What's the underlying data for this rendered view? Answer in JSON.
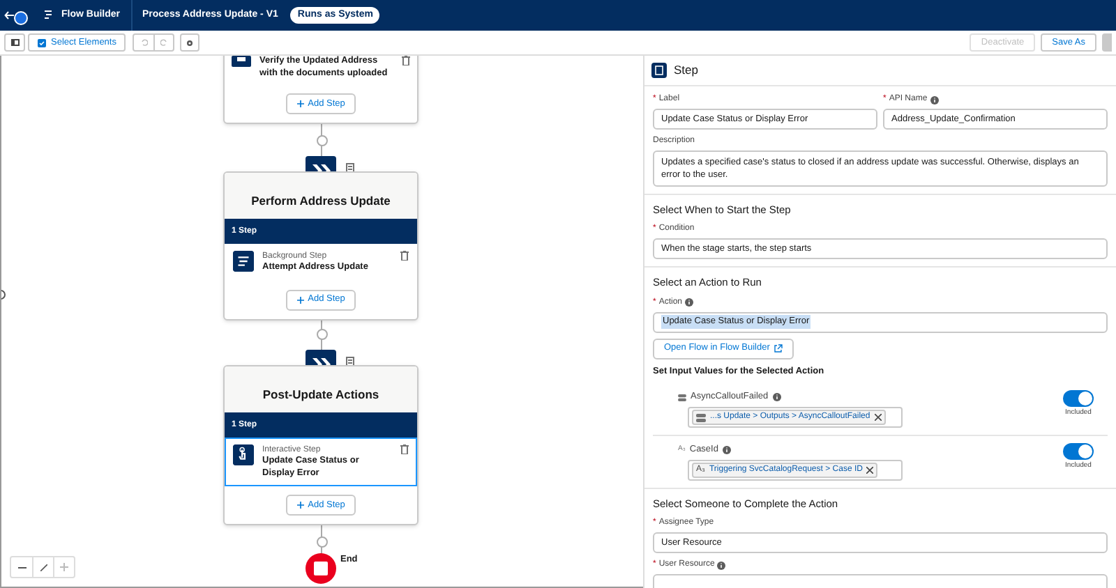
{
  "header": {
    "app_name": "Flow Builder",
    "flow_title": "Process Address Update - V1",
    "run_badge": "Runs as System"
  },
  "toolbar": {
    "select_elements": "Select Elements",
    "actions": [
      {
        "label": "Deactivate",
        "disabled": true
      },
      {
        "label": "Save As",
        "disabled": false
      }
    ]
  },
  "canvas": {
    "stages": [
      {
        "kind": "partial",
        "steps": [
          {
            "kind": "screen",
            "name": "Verify the Updated Address with the documents uploaded",
            "selected": false
          }
        ],
        "add_step": "Add Step"
      },
      {
        "kind": "full",
        "title": "Perform Address Update",
        "count": "1 Step",
        "steps": [
          {
            "kind": "background",
            "type": "Background Step",
            "name": "Attempt Address Update",
            "selected": false
          }
        ],
        "add_step": "Add Step"
      },
      {
        "kind": "full",
        "title": "Post-Update Actions",
        "count": "1 Step",
        "steps": [
          {
            "kind": "interactive",
            "type": "Interactive Step",
            "name": "Update Case Status or Display Error",
            "selected": true
          }
        ],
        "add_step": "Add Step"
      }
    ],
    "end_label": "End"
  },
  "panel": {
    "title": "Step",
    "label": {
      "required_mark": "*",
      "label": "Label",
      "value": "Update Case Status or Display Error"
    },
    "api_name": {
      "required_mark": "*",
      "label": "API Name",
      "value": "Address_Update_Confirmation"
    },
    "description": {
      "label": "Description",
      "value": "Updates a specified case's status to closed if an address update was successful. Otherwise, displays an error to the user."
    },
    "start_section": {
      "title": "Select When to Start the Step",
      "condition": {
        "required_mark": "*",
        "label": "Condition",
        "value": "When the stage starts, the step starts"
      }
    },
    "action_section": {
      "title": "Select an Action to Run",
      "action": {
        "required_mark": "*",
        "label": "Action",
        "value": "Update Case Status or Display Error"
      },
      "open_button": "Open Flow in Flow Builder",
      "inputs_title": "Set Input Values for the Selected Action",
      "inputs": [
        {
          "name": "AsyncCalloutFailed",
          "kind": "boolean",
          "value": "...s Update > Outputs > AsyncCalloutFailed",
          "included": true,
          "toggle_label": "Included"
        },
        {
          "name": "CaseId",
          "kind": "text",
          "type_mark": "A₃",
          "value_mark": "A₃",
          "value": "Triggering SvcCatalogRequest > Case ID",
          "included": true,
          "toggle_label": "Included"
        }
      ]
    },
    "assignee_section": {
      "title": "Select Someone to Complete the Action",
      "assignee_type": {
        "required_mark": "*",
        "label": "Assignee Type",
        "value": "User Resource"
      },
      "user_resource": {
        "required_mark": "*",
        "label": "User Resource"
      }
    }
  }
}
